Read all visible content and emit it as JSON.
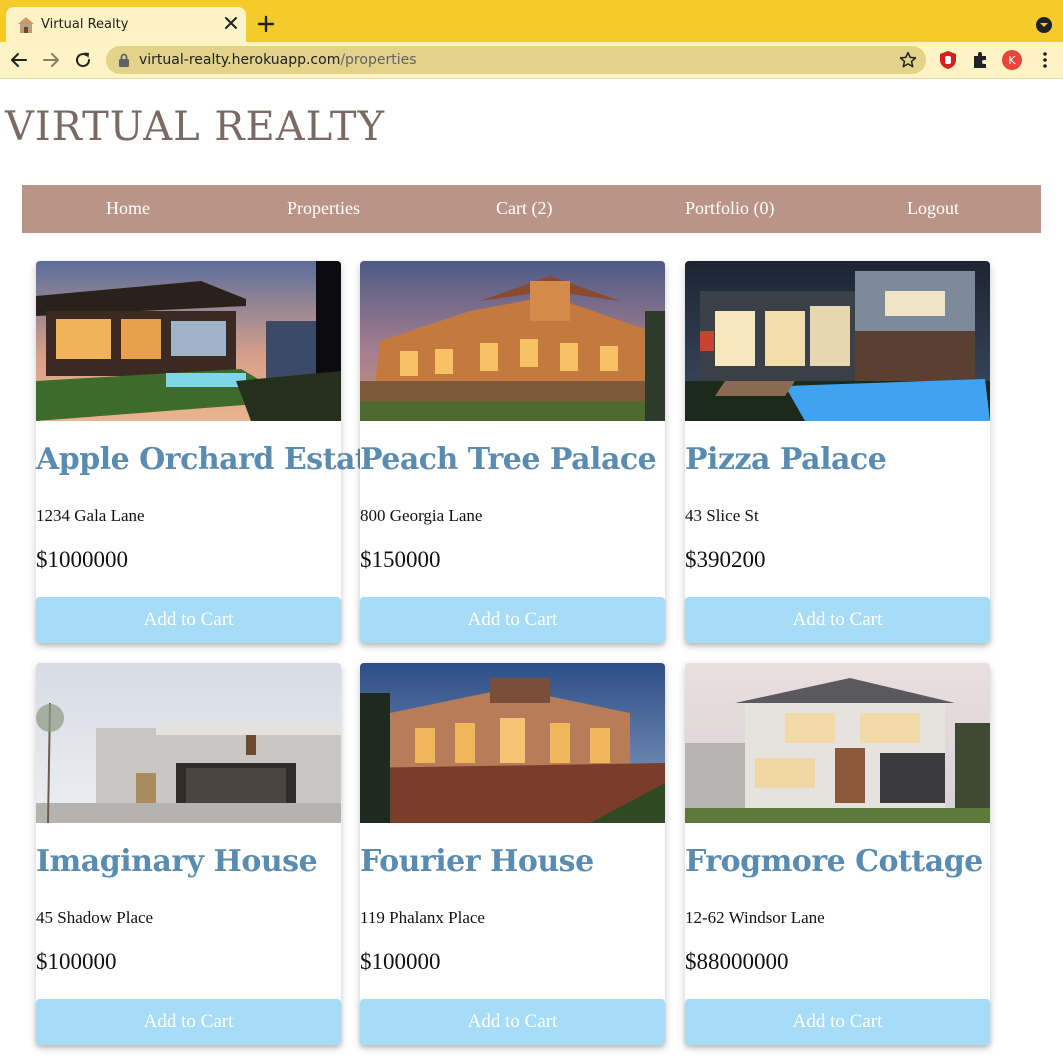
{
  "browser": {
    "tab_title": "Virtual Realty",
    "url_domain": "virtual-realty.herokuapp.com",
    "url_path": "/properties",
    "profile_initial": "K",
    "accent_color": "#f4cb2b"
  },
  "site": {
    "title": "VIRTUAL REALTY"
  },
  "nav": {
    "home": "Home",
    "properties": "Properties",
    "cart": "Cart (2)",
    "portfolio": "Portfolio (0)",
    "logout": "Logout"
  },
  "properties": [
    {
      "name": "Apple Orchard Estate",
      "address": "1234 Gala Lane",
      "price": "$1000000",
      "button": "Add to Cart"
    },
    {
      "name": "Peach Tree Palace",
      "address": "800 Georgia Lane",
      "price": "$150000",
      "button": "Add to Cart"
    },
    {
      "name": "Pizza Palace",
      "address": "43 Slice St",
      "price": "$390200",
      "button": "Add to Cart"
    },
    {
      "name": "Imaginary House",
      "address": "45 Shadow Place",
      "price": "$100000",
      "button": "Add to Cart"
    },
    {
      "name": "Fourier House",
      "address": "119 Phalanx Place",
      "price": "$100000",
      "button": "Add to Cart"
    },
    {
      "name": "Frogmore Cottage",
      "address": "12-62 Windsor Lane",
      "price": "$88000000",
      "button": "Add to Cart"
    }
  ]
}
